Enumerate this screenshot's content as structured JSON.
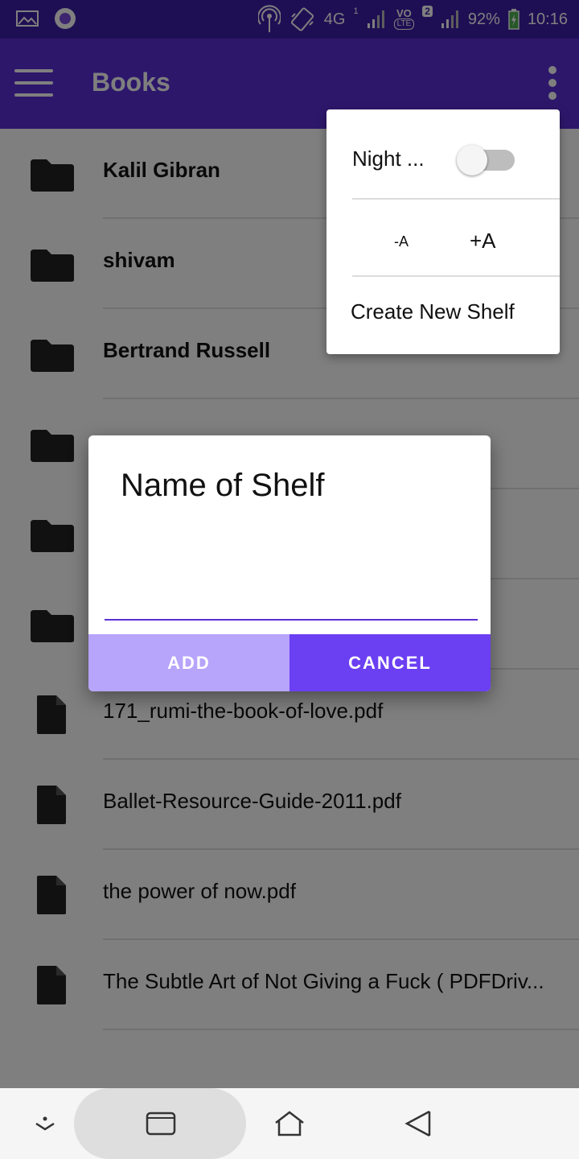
{
  "status_bar": {
    "network": "4G",
    "volte": "VO",
    "lte": "LTE",
    "sim1": "1",
    "sim2": "2",
    "battery": "92%",
    "time": "10:16"
  },
  "app_bar": {
    "title": "Books"
  },
  "items": [
    {
      "label": "Kalil Gibran",
      "type": "folder"
    },
    {
      "label": "shivam",
      "type": "folder"
    },
    {
      "label": "Bertrand Russell",
      "type": "folder"
    },
    {
      "label": "",
      "type": "folder"
    },
    {
      "label": "",
      "type": "folder"
    },
    {
      "label": "",
      "type": "folder"
    },
    {
      "label": "171_rumi-the-book-of-love.pdf",
      "type": "file"
    },
    {
      "label": "Ballet-Resource-Guide-2011.pdf",
      "type": "file"
    },
    {
      "label": "the power of now.pdf",
      "type": "file"
    },
    {
      "label": "The Subtle Art of Not Giving a Fuck ( PDFDriv...",
      "type": "file"
    }
  ],
  "overflow_menu": {
    "night_label": "Night ...",
    "night_enabled": false,
    "decrease_font": "-A",
    "increase_font": "+A",
    "create_shelf": "Create New Shelf"
  },
  "dialog": {
    "title": "Name of Shelf",
    "input_value": "",
    "add_label": "ADD",
    "cancel_label": "CANCEL"
  },
  "colors": {
    "status_bar": "#3d1fa8",
    "app_bar": "#5b2fd6",
    "add_button": "#b7a4fb",
    "cancel_button": "#6b3ff2",
    "accent": "#5b2fd6"
  },
  "nav_bar": {
    "icons": [
      "hide-keyboard-icon",
      "recents-icon",
      "home-icon",
      "back-icon"
    ]
  }
}
